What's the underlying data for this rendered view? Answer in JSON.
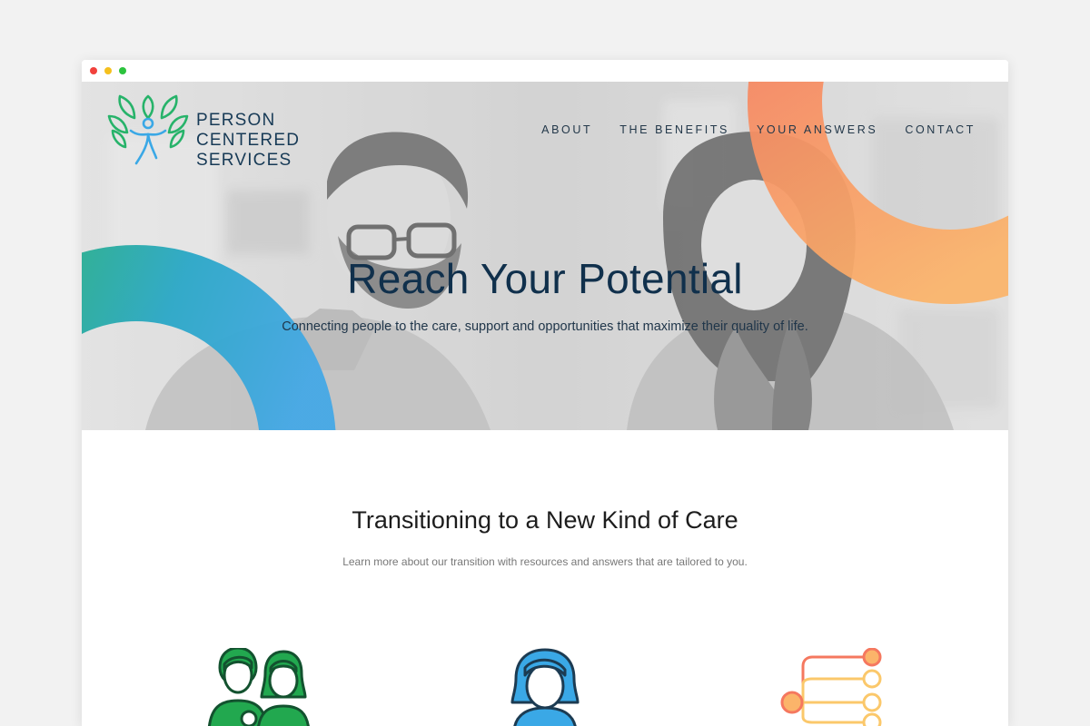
{
  "brand": {
    "line1": "PERSON",
    "line2": "CENTERED",
    "line3": "SERVICES"
  },
  "nav": {
    "about": "ABOUT",
    "benefits": "THE BENEFITS",
    "answers": "YOUR ANSWERS",
    "contact": "CONTACT"
  },
  "hero": {
    "title": "Reach Your Potential",
    "subtitle": "Connecting people to the care, support and opportunities that maximize their quality of life."
  },
  "section": {
    "title": "Transitioning to a New Kind of Care",
    "subtitle": "Learn more about our transition with resources and answers that are tailored to you."
  },
  "icons": {
    "family": "family-icon",
    "person": "woman-avatar-icon",
    "flow": "flowchart-icon"
  },
  "colors": {
    "brand_dark": "#10304c",
    "green": "#22a84f",
    "blue": "#3aa8e6",
    "orange": "#f58a6a",
    "yellow": "#fbc86b"
  }
}
